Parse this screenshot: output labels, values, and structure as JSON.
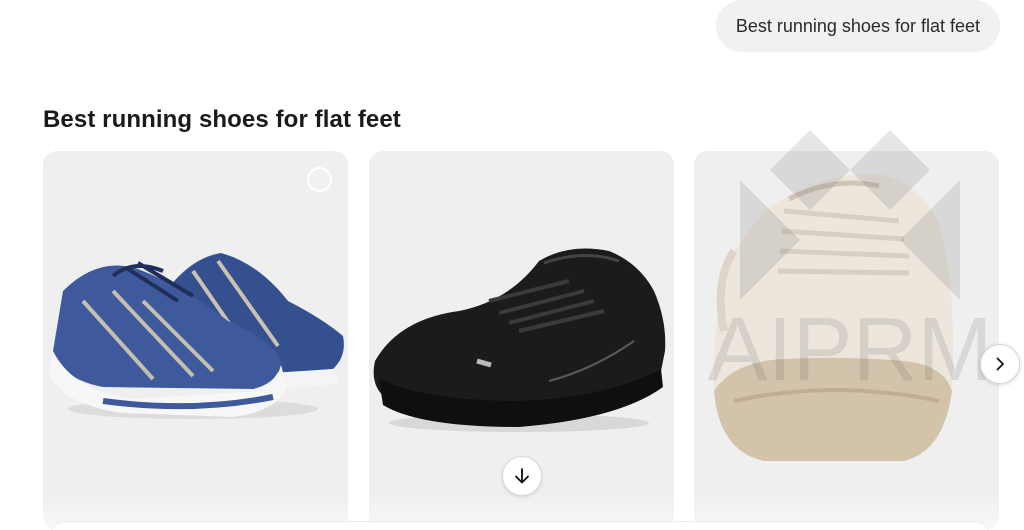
{
  "conversation": {
    "user_query": "Best running shoes for flat feet"
  },
  "results": {
    "title": "Best running shoes for flat feet",
    "cards": [
      {
        "image": "blue-running-shoe-image",
        "has_select": true,
        "has_download": false
      },
      {
        "image": "black-running-shoe-image",
        "has_select": false,
        "has_download": true
      },
      {
        "image": "white-running-shoe-image",
        "has_select": false,
        "has_download": false
      }
    ]
  },
  "watermark": {
    "text": "AIPRM"
  },
  "icons": {
    "next": "chevron-right-icon",
    "download": "arrow-down-icon",
    "select": "circle-select-icon"
  },
  "colors": {
    "card_bg": "#efefef",
    "bubble_bg": "#f1f1f1",
    "shoe_blue": "#3f5a9c",
    "shoe_black": "#1b1b1b",
    "shoe_white": "#ece6dc"
  }
}
